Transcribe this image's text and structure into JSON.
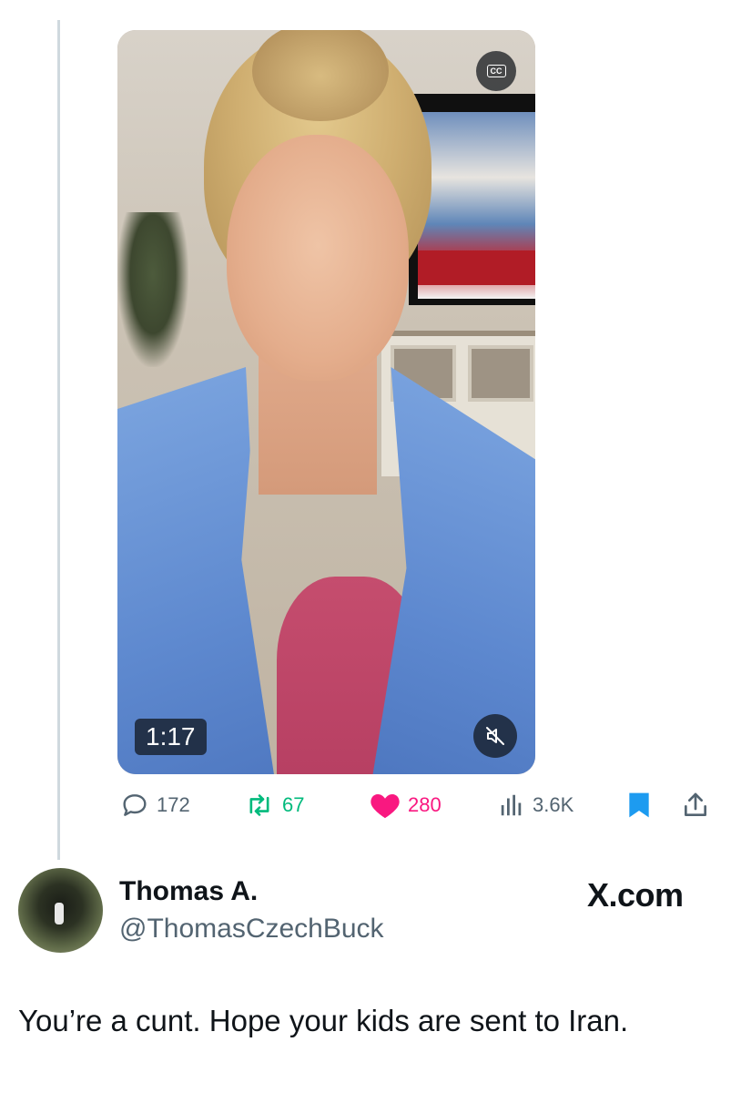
{
  "video": {
    "cc_label": "CC",
    "duration": "1:17"
  },
  "actions": {
    "replies": "172",
    "reposts": "67",
    "likes": "280",
    "views": "3.6K"
  },
  "colors": {
    "repost": "#00ba7c",
    "like": "#f91880",
    "bookmark": "#1d9bf0",
    "secondary_text": "#536471",
    "thread_line": "#cfd9de"
  },
  "reply": {
    "display_name": "Thomas A.",
    "handle": "@ThomasCzechBuck",
    "watermark": "X.com",
    "text": "You’re a cunt. Hope your kids are sent to Iran."
  }
}
